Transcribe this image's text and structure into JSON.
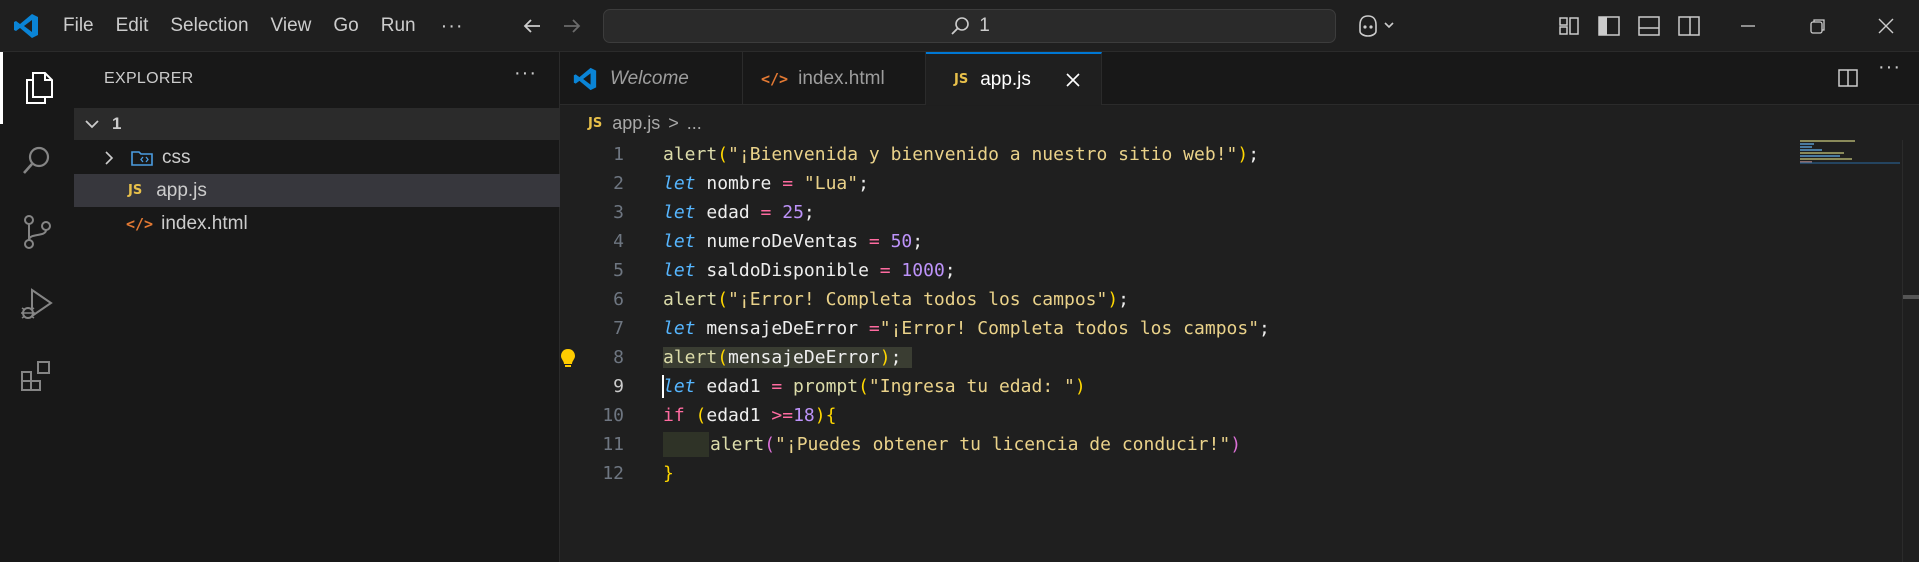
{
  "menu": [
    "File",
    "Edit",
    "Selection",
    "View",
    "Go",
    "Run"
  ],
  "menu_more": "···",
  "command_center": {
    "text": "1"
  },
  "sidebar": {
    "title": "EXPLORER",
    "more": "···",
    "folder": "1",
    "items": [
      {
        "badge": "",
        "label": "css",
        "type": "folder"
      },
      {
        "badge": "JS",
        "label": "app.js",
        "type": "js"
      },
      {
        "badge": "</>",
        "label": "index.html",
        "type": "html"
      }
    ]
  },
  "tabs": [
    {
      "label": "Welcome"
    },
    {
      "label": "index.html",
      "badge": "</>"
    },
    {
      "label": "app.js",
      "badge": "JS"
    }
  ],
  "breadcrumb": {
    "badge": "JS",
    "file": "app.js",
    "sep": ">",
    "rest": "..."
  },
  "editor": {
    "line_numbers": [
      "1",
      "2",
      "3",
      "4",
      "5",
      "6",
      "7",
      "8",
      "9",
      "10",
      "11",
      "12"
    ],
    "lines": {
      "l1": {
        "fn": "alert",
        "p1": "(",
        "s": "\"¡Bienvenida y bienvenido a nuestro sitio web!\"",
        "p2": ")",
        "end": ";"
      },
      "l2": {
        "kw": "let",
        "id": " nombre ",
        "op": "=",
        "s": " \"Lua\"",
        "end": ";"
      },
      "l3": {
        "kw": "let",
        "id": " edad ",
        "op": "=",
        "n": " 25",
        "end": ";"
      },
      "l4": {
        "kw": "let",
        "id": " numeroDeVentas ",
        "op": "=",
        "n": " 50",
        "end": ";"
      },
      "l5": {
        "kw": "let",
        "id": " saldoDisponible ",
        "op": "=",
        "n": " 1000",
        "end": ";"
      },
      "l6": {
        "fn": "alert",
        "p1": "(",
        "s": "\"¡Error! Completa todos los campos\"",
        "p2": ")",
        "end": ";"
      },
      "l7": {
        "kw": "let",
        "id": " mensajeDeError ",
        "op": "=",
        "s": "\"¡Error! Completa todos los campos\"",
        "end": ";"
      },
      "l8": {
        "fn": "alert",
        "p1": "(",
        "id": "mensajeDeError",
        "p2": ")",
        "end": ";"
      },
      "l9": {
        "kw": "let",
        "id": " edad1 ",
        "op": "=",
        "fn": " prompt",
        "p1": "(",
        "s": "\"Ingresa tu edad: \"",
        "p2": ")"
      },
      "l10": {
        "kw": "if",
        "p1": " (",
        "id": "edad1 ",
        "op": ">=",
        "n": "18",
        "p2": ")",
        "brace": "{"
      },
      "l11": {
        "fn": "alert",
        "p1": "(",
        "s": "\"¡Puedes obtener tu licencia de conducir!\"",
        "p2": ")"
      },
      "l12": {
        "brace": "}"
      }
    }
  },
  "colors": {
    "accent": "#0078d4",
    "keyword": "#56b6ff",
    "function": "#dcdcaa",
    "string": "#ead28a",
    "number": "#bd93f9",
    "operator": "#ff6ba0"
  }
}
